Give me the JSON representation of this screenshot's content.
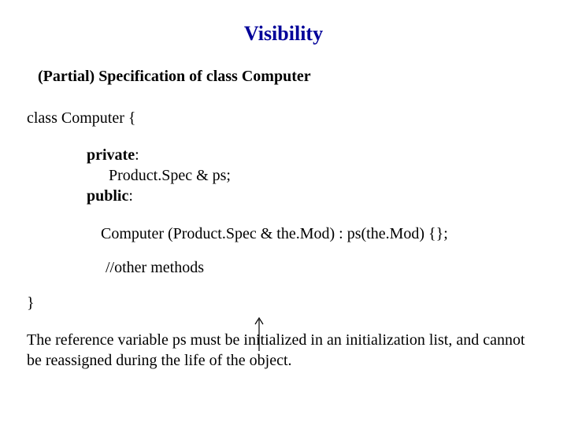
{
  "title": "Visibility",
  "subtitle": "(Partial) Specification of class Computer",
  "code": {
    "open": "class Computer {",
    "private_kw": "private",
    "private_suffix": ":",
    "member": "Product.Spec & ps;",
    "public_kw": "public",
    "public_suffix": ":",
    "constructor": "Computer (Product.Spec &  the.Mod) : ps(the.Mod) {};",
    "comment": "//other methods",
    "close": "}"
  },
  "note": "The reference variable ps must be initialized in an initialization list, and cannot be reassigned during the life of the object."
}
